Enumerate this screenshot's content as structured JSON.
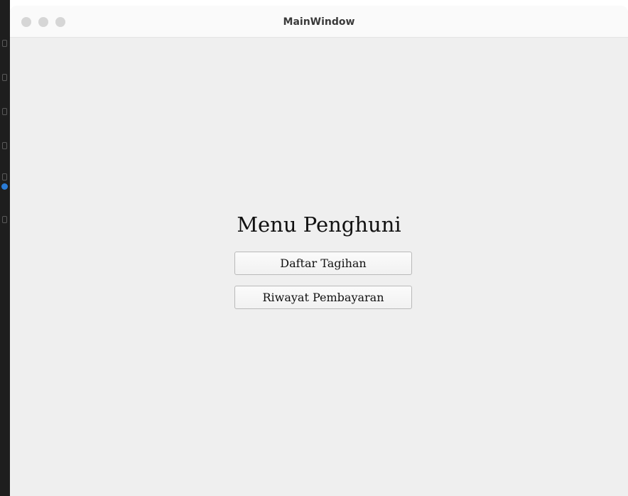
{
  "window": {
    "title": "MainWindow",
    "controls": [
      "close",
      "minimize",
      "maximize"
    ]
  },
  "main": {
    "heading": "Menu Penghuni",
    "buttons": [
      {
        "label": "Daftar Tagihan"
      },
      {
        "label": "Riwayat Pembayaran"
      }
    ]
  },
  "colors": {
    "window_background": "#efefef",
    "titlebar_background": "#fafafa",
    "traffic_light": "#d6d6d6",
    "dock_background": "#1e1e1e",
    "dock_badge": "#2a7bd6"
  }
}
